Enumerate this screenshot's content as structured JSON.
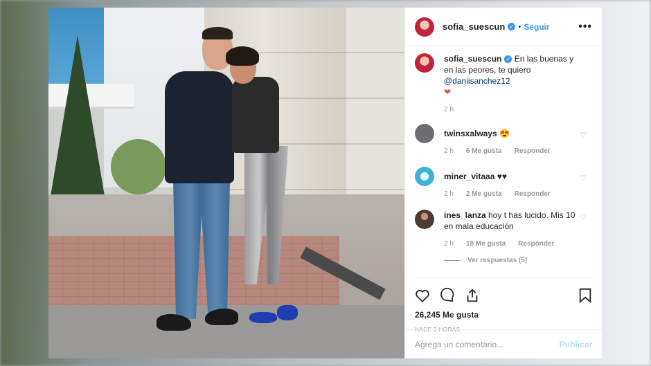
{
  "post": {
    "author": "sofia_suescun",
    "follow_label": "Seguir",
    "separator": "•",
    "more_label": "•••",
    "caption_text": "En las buenas y en las peores, te quiero ",
    "caption_mention": "@daniisanchez12",
    "caption_emoji": "❤",
    "caption_time": "2 h",
    "likes": "26,245 Me gusta",
    "posted_ago": "HACE 2 HORAS",
    "comment_placeholder": "Agrega un comentario...",
    "publish_label": "Publicar"
  },
  "comments": [
    {
      "user": "twinsxalways",
      "text": "😍",
      "time": "2 h",
      "likes": "6 Me gusta",
      "reply": "Responder",
      "avatar_color": "#6b6f74"
    },
    {
      "user": "miner_vitaaa",
      "text": "♥♥",
      "time": "2 h",
      "likes": "2 Me gusta",
      "reply": "Responder",
      "avatar_color": "#3fb2d8"
    },
    {
      "user": "ines_lanza",
      "text": "hoy t has lucido. Mis 10 en mala educación",
      "time": "2 h",
      "likes": "18 Me gusta",
      "reply": "Responder",
      "avatar_color": "#4b3b32",
      "view_replies": "Ver respuestas (5)"
    }
  ],
  "colors": {
    "accent": "#3897f0",
    "heart": "#ed4956"
  }
}
